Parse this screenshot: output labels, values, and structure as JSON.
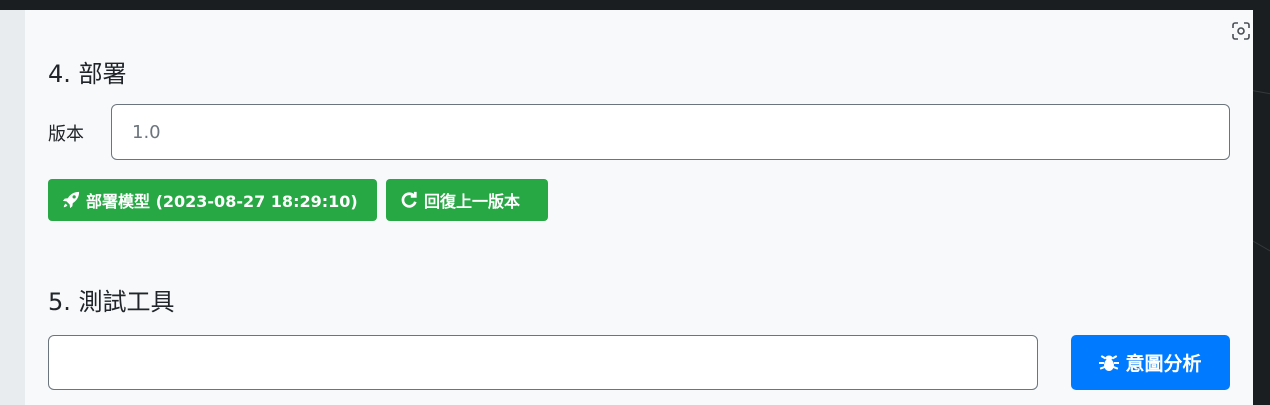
{
  "deploy": {
    "heading": "4. 部署",
    "version_label": "版本",
    "version_value": "1.0",
    "deploy_button": "部署模型 (2023-08-27 18:29:10)",
    "revert_button": "回復上一版本"
  },
  "test_tools": {
    "heading": "5. 測試工具",
    "input_value": "",
    "intent_button": "意圖分析"
  },
  "colors": {
    "green": "#28a745",
    "blue": "#007bff"
  },
  "icons": [
    "rocket-icon",
    "redo-icon",
    "bug-icon",
    "scan-icon"
  ]
}
